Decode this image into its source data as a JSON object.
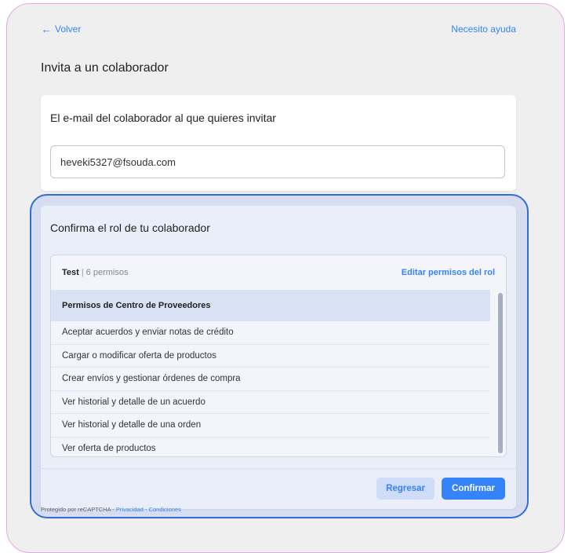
{
  "nav": {
    "back_label": "Volver",
    "help_label": "Necesito ayuda"
  },
  "page": {
    "title": "Invita a un colaborador"
  },
  "email_section": {
    "title": "El e-mail del colaborador al que quieres invitar",
    "value": "heveki5327@fsouda.com"
  },
  "role_section": {
    "title": "Confirma el rol de tu colaborador",
    "role_name": "Test",
    "separator": "|",
    "permission_count": "6 permisos",
    "edit_link": "Editar permisos del rol",
    "group_header": "Permisos de Centro de Proveedores",
    "permissions": [
      "Aceptar acuerdos y enviar notas de crédito",
      "Cargar o modificar oferta de productos",
      "Crear envíos y gestionar órdenes de compra",
      "Ver historial y detalle de un acuerdo",
      "Ver historial y detalle de una orden",
      "Ver oferta de productos"
    ],
    "back_button": "Regresar",
    "confirm_button": "Confirmar"
  },
  "footer": {
    "recaptcha_text": "Protegido por reCAPTCHA - ",
    "privacy_link": "Privacidad",
    "dash": " - ",
    "terms_link": "Condiciones"
  },
  "colors": {
    "accent": "#3483fa",
    "highlight_border": "#2f6fd6",
    "frame_border": "#e7a6e7"
  }
}
